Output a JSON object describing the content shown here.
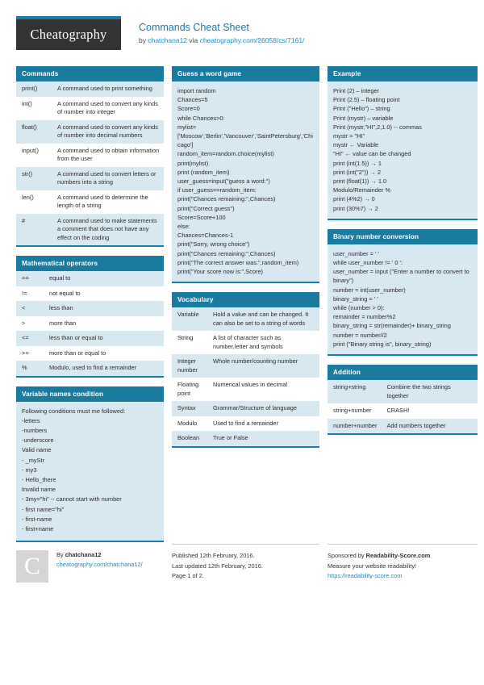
{
  "header": {
    "logo_text": "Cheatography",
    "sheet_title": "Commands Cheat Sheet",
    "by_prefix": "by ",
    "author": "chatchana12",
    "via": " via ",
    "source_url": "cheatography.com/26058/cs/7161/"
  },
  "cards": {
    "commands": {
      "title": "Commands",
      "rows": [
        {
          "k": "print()",
          "v": "A command used to print something"
        },
        {
          "k": "int()",
          "v": "A command used to convert any kinds of number into integer"
        },
        {
          "k": "float()",
          "v": "A command used to convert any kinds of number into decimal numbers"
        },
        {
          "k": "input()",
          "v": "A command used to obtain information from the user"
        },
        {
          "k": "str()",
          "v": "A command used to convert letters or numbers into a string"
        },
        {
          "k": "len()",
          "v": "A command used to determine the length of a string"
        },
        {
          "k": "#",
          "v": "A command used to make statements a comment that does not have any effect on the coding"
        }
      ]
    },
    "math_operators": {
      "title": "Mathematical operators",
      "rows": [
        {
          "k": "==",
          "v": "equal to"
        },
        {
          "k": "!=",
          "v": "not equal to"
        },
        {
          "k": "<",
          "v": "less than"
        },
        {
          "k": ">",
          "v": "more than"
        },
        {
          "k": "<=",
          "v": "less than or equal to"
        },
        {
          "k": ">=",
          "v": "more than or equal to"
        },
        {
          "k": "%",
          "v": "Modulo, used to find a remainder"
        }
      ]
    },
    "variable_names": {
      "title": "Variable names condition",
      "lines": [
        "Following conditions must me followed:",
        "-letters",
        "-numbers",
        "-underscore",
        "Valid name",
        "- _myStr",
        "- my3",
        "- Hello_there",
        "Invalid name",
        "- 3my=\"hi\" -- cannot start with number",
        "- first name=\"hi\"",
        "- first-name",
        "- first+name"
      ]
    },
    "guess_word_game": {
      "title": "Guess a word game",
      "lines": [
        "import random",
        "Chances=5",
        "Score=0",
        "while Chances>0:",
        "mylist=",
        "['Moscow','Berlin','Vancouver','SaintPetersburg','Chicago']",
        "random_item=random.choice(mylist)",
        "print(mylist)",
        "print (random_item)",
        "user_guess=input(\"guess a word:\")",
        "if user_guess==random_item:",
        "print(\"Chances remaining:\",Chances)",
        "print(\"Correct guess\")",
        "Score=Score+100",
        "else:",
        "Chances=Chances-1",
        "print(\"Sorry, wrong choice\")",
        "print(\"Chances remaining:\",Chances)",
        "print(\"The correct answer was:\",random_item)",
        "print(\"Your score now is:\",Score)"
      ]
    },
    "vocabulary": {
      "title": "Vocabulary",
      "rows": [
        {
          "k": "Variable",
          "v": "Hold a value and can be changed. It can also be set to a string of words"
        },
        {
          "k": "String",
          "v": "A list of character such as number,letter and symbols"
        },
        {
          "k": "Integer number",
          "v": "Whole number/counting number"
        },
        {
          "k": "Floating point",
          "v": "Numerical values in decimal"
        },
        {
          "k": "Syntax",
          "v": "Grammar/Structure of language"
        },
        {
          "k": "Modulo",
          "v": "Used to find a remainder"
        },
        {
          "k": "Boolean",
          "v": "True or False"
        }
      ]
    },
    "example": {
      "title": "Example",
      "lines": [
        "Print (2) – integer",
        "Print (2.5) – floating point",
        "Print (\"Hello\") – string",
        "Print (mystr) – variable",
        "Print (mystr,\"HI\",2,1.0) -- commas",
        "mystr = \"HI\"",
        "mystr ← Variable",
        "\"HI\" ← value can be changed",
        "print (int(1.5)) → 1",
        "print (int(\"2\")) → 2",
        "print (float(1)) → 1.0",
        "Modulo/Remainder %",
        "print (4%2) → 0",
        "print (30%7) → 2"
      ]
    },
    "binary_conversion": {
      "title": "Binary number conversion",
      "lines": [
        "user_number = ' '",
        "while user_number != ' 0 ':",
        "user_number = input (\"Enter a number to convert to binary\")",
        "number = int(user_number)",
        "binary_string = ' '",
        "while (number > 0):",
        "remainder = number%2",
        "binary_string = str(remainder)+ binary_string",
        "number = number//2",
        "print (\"Binary string is\", binary_string)"
      ]
    },
    "addition": {
      "title": "Addition",
      "rows": [
        {
          "k": "string+string",
          "v": "Combine the two strings together"
        },
        {
          "k": "string+number",
          "v": "CRASH!"
        },
        {
          "k": "number+number",
          "v": "Add numbers together"
        }
      ]
    }
  },
  "footer": {
    "avatar_letter": "C",
    "by_label": "By ",
    "author": "chatchana12",
    "author_url": "cheatography.com/chatchana12/",
    "published": "Published 12th February, 2016.",
    "updated": "Last updated 12th February, 2016.",
    "page": "Page 1 of 2.",
    "sponsor_prefix": "Sponsored by ",
    "sponsor_name": "Readability-Score.com",
    "sponsor_tagline": "Measure your website readability!",
    "sponsor_url": "https://readability-score.com"
  },
  "colors": {
    "accent": "#1a7b9e",
    "link": "#1b8fc4",
    "row_alt": "#d8e8f0",
    "logo_bg": "#333333"
  }
}
